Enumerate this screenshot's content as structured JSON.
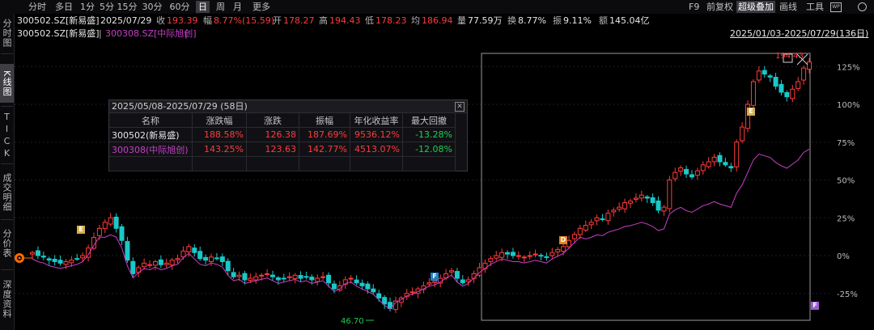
{
  "sidebar": {
    "tabs": [
      {
        "label": "分时图",
        "active": false
      },
      {
        "label": "K线图",
        "active": true
      },
      {
        "label": "TICK",
        "active": false
      },
      {
        "label": "成交明细",
        "active": false
      },
      {
        "label": "分价表",
        "active": false
      },
      {
        "label": "深度资料",
        "active": false
      }
    ]
  },
  "periods": {
    "items": [
      "分时",
      "多日",
      "1分",
      "5分",
      "15分",
      "30分",
      "60分",
      "日",
      "周",
      "月",
      "更多"
    ],
    "active": "日"
  },
  "toolbar_right": {
    "f9": "F9",
    "prev_adj": "前复权",
    "overlay": "超级叠加",
    "draw": "画线",
    "tools": "工具"
  },
  "quote": {
    "code": "300502.SZ[新易盛]",
    "date": "2025/07/29",
    "close_label": "收",
    "close": "193.39",
    "chg_label": "幅",
    "chg": "8.77%(15.59)",
    "open_label": "开",
    "open": "178.27",
    "high_label": "高",
    "high": "194.43",
    "low_label": "低",
    "low": "178.23",
    "avg_label": "均",
    "avg": "186.94",
    "vol_label": "量",
    "vol": "77.59万",
    "turnover_label": "换",
    "turnover": "8.77%",
    "amp_label": "振",
    "amp": "9.11%",
    "amount_label": "额",
    "amount": "145.04亿"
  },
  "legend": {
    "main": "300502.SZ[新易盛]",
    "sep": "|",
    "overlay": "300308.SZ[中际旭创]",
    "sep2": "|",
    "range": "2025/01/03-2025/07/29(136日)"
  },
  "axis": {
    "y_labels": [
      "125%",
      "100%",
      "75%",
      "50%",
      "25%",
      "0%",
      "-25%"
    ]
  },
  "annotations": {
    "high": "194.43",
    "low": "46.70"
  },
  "stats_panel": {
    "title": "2025/05/08-2025/07/29 (58日)",
    "close_icon": "close-icon",
    "headers": [
      "名称",
      "涨跌幅",
      "涨跌",
      "振幅",
      "年化收益率",
      "最大回撤"
    ],
    "rows": [
      {
        "name": "300502(新易盛)",
        "chg_pct": "188.58%",
        "chg": "126.38",
        "amp": "187.69%",
        "annual": "9536.12%",
        "mdd": "-13.28%"
      },
      {
        "name": "300308(中际旭创)",
        "chg_pct": "143.25%",
        "chg": "123.63",
        "amp": "142.77%",
        "annual": "4513.07%",
        "mdd": "-12.08%"
      }
    ]
  },
  "markers": [
    "E",
    "F",
    "D",
    "E",
    "F"
  ],
  "colors": {
    "up": "#ff3b3b",
    "down": "#19c9c9",
    "overlay": "#c93ec9",
    "grid": "#1e1e24"
  }
}
